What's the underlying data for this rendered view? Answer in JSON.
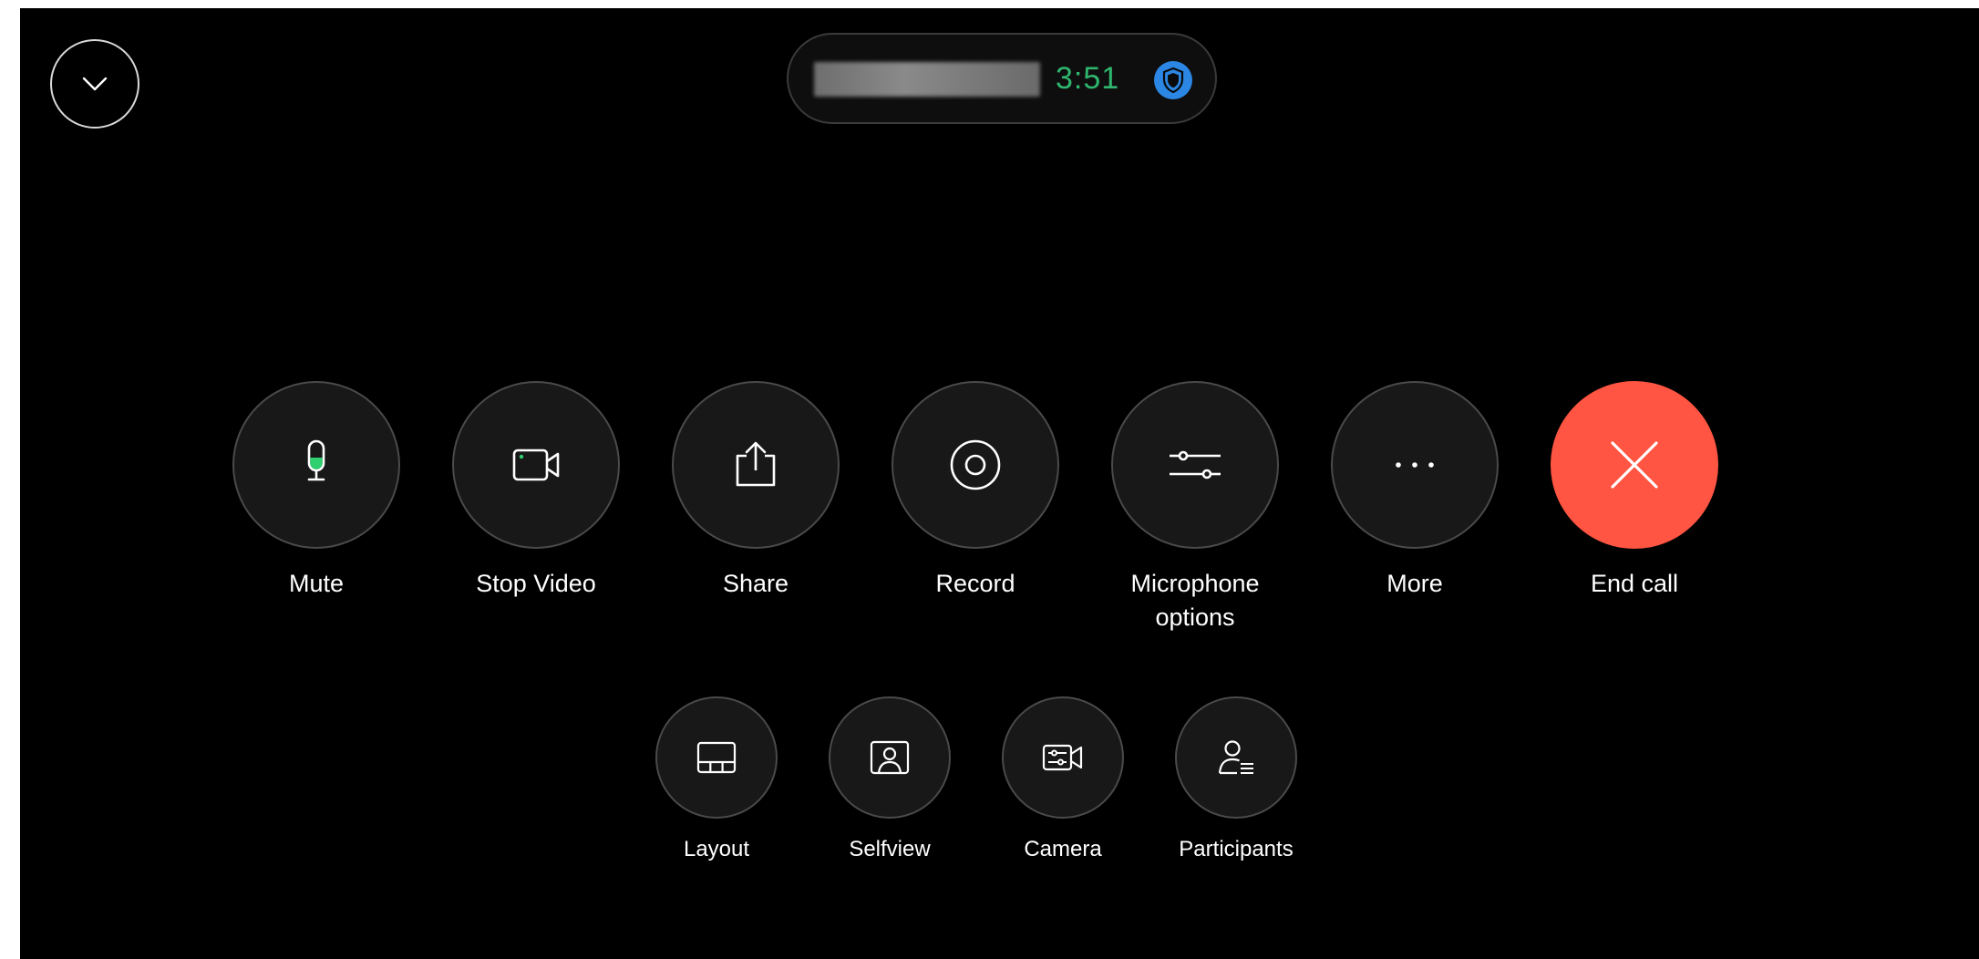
{
  "colors": {
    "background": "#000000",
    "timer": "#2fb66e",
    "end_call": "#ff5542",
    "mic_level": "#2fd06f",
    "security_badge": "#2b86e4"
  },
  "header": {
    "collapse_icon": "chevron-down-icon",
    "timer": "3:51",
    "security_icon": "shield-icon"
  },
  "controls": [
    {
      "label": "Mute",
      "icon": "microphone-icon"
    },
    {
      "label": "Stop Video",
      "icon": "video-camera-icon"
    },
    {
      "label": "Share",
      "icon": "share-icon"
    },
    {
      "label": "Record",
      "icon": "record-icon"
    },
    {
      "label": "Microphone options",
      "icon": "sliders-icon"
    },
    {
      "label": "More",
      "icon": "more-dots-icon"
    },
    {
      "label": "End call",
      "icon": "close-icon"
    }
  ],
  "secondary_controls": [
    {
      "label": "Layout",
      "icon": "layout-icon"
    },
    {
      "label": "Selfview",
      "icon": "selfview-icon"
    },
    {
      "label": "Camera",
      "icon": "camera-settings-icon"
    },
    {
      "label": "Participants",
      "icon": "participants-icon"
    }
  ]
}
